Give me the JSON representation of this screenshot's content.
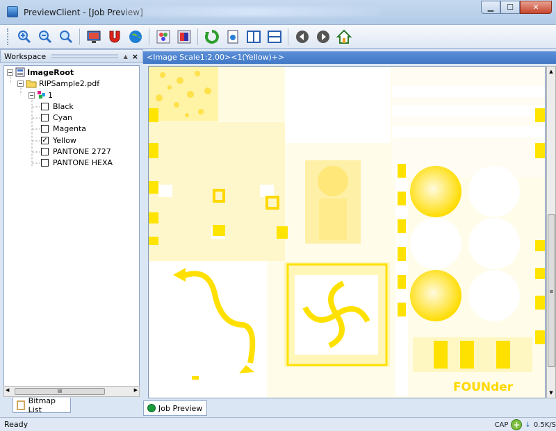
{
  "window": {
    "title": "PreviewClient - [Job Preview]",
    "minimize": "▁",
    "maximize": "☐",
    "close": "✕"
  },
  "toolbar": {
    "icons": [
      "zoom-in-icon",
      "zoom-out-icon",
      "zoom-fit-icon",
      "monitor-icon",
      "magnet-icon",
      "globe-icon",
      "color-grid-icon",
      "color-picker-icon",
      "refresh-icon",
      "page-icon",
      "split-vertical-icon",
      "split-horizontal-icon",
      "previous-icon",
      "next-icon",
      "home-icon"
    ],
    "glyphs": [
      "🔍",
      "🔎",
      "🔍",
      "🖥",
      "U",
      "◕",
      "▦",
      "▣",
      "⟳",
      "▤",
      "◫",
      "☰",
      "◀",
      "▶",
      "⌂"
    ]
  },
  "workspace": {
    "title": "Workspace",
    "pin": "▲",
    "close": "×",
    "tree": {
      "root": "ImageRoot",
      "file": "RIPSample2.pdf",
      "page": "1",
      "separations": [
        {
          "label": "Black",
          "checked": false
        },
        {
          "label": "Cyan",
          "checked": false
        },
        {
          "label": "Magenta",
          "checked": false
        },
        {
          "label": "Yellow",
          "checked": true
        },
        {
          "label": "PANTONE 2727",
          "checked": false
        },
        {
          "label": "PANTONE HEXA",
          "checked": false
        }
      ]
    },
    "bottom_tab": "Bitmap List",
    "scroll_left": "◀",
    "scroll_right": "▶",
    "scroll_thumb": "III"
  },
  "document": {
    "header": "<Image Scale1:2.00><1(Yellow)+>",
    "logo_text": "FOUNder",
    "tab": "Job Preview",
    "scroll_up": "▲",
    "scroll_down": "▼",
    "scroll_thumb": "≡"
  },
  "status": {
    "left": "Ready",
    "cap": "CAP",
    "speed": "0.5K/S",
    "down_arrow": "↓"
  },
  "colors": {
    "yellow": "#ffe800",
    "accent": "#4178c5"
  }
}
